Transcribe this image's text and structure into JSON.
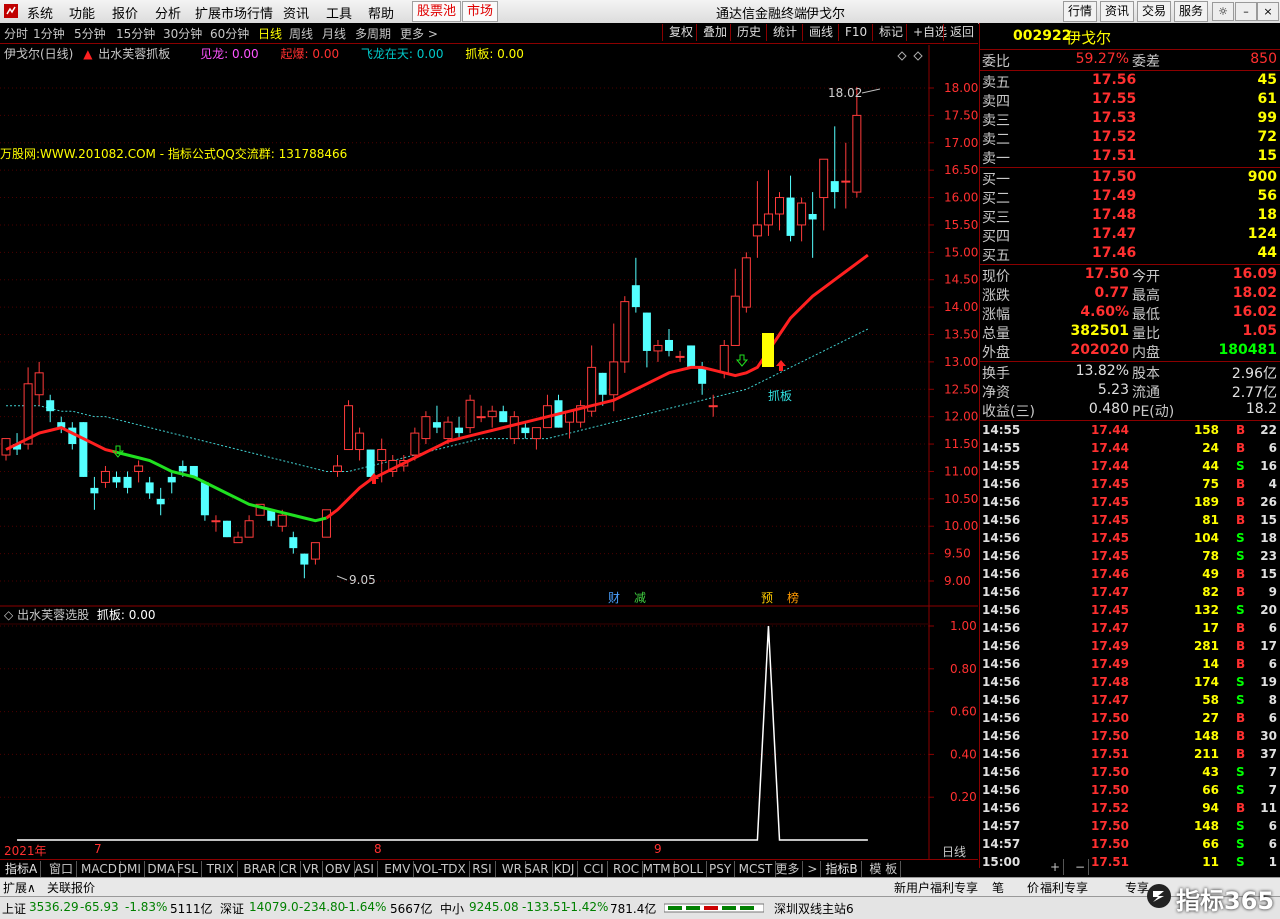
{
  "menu": {
    "items": [
      "系统",
      "功能",
      "报价",
      "分析",
      "扩展市场行情",
      "资讯",
      "工具",
      "帮助"
    ],
    "red_buttons": [
      "股票池",
      "市场"
    ],
    "title": "通达信金融终端",
    "stock_name": "伊戈尔",
    "right_buttons": [
      "行情",
      "资讯",
      "交易",
      "服务"
    ]
  },
  "periods": {
    "items": [
      "分时",
      "1分钟",
      "5分钟",
      "15分钟",
      "30分钟",
      "60分钟",
      "日线",
      "周线",
      "月线",
      "多周期",
      "更多 >"
    ],
    "active": "日线"
  },
  "tools": [
    "复权",
    "叠加",
    "历史",
    "统计",
    "画线",
    "F10",
    "标记",
    "+自选",
    "返回"
  ],
  "main_chart": {
    "label": "伊戈尔(日线)",
    "formula": "出水芙蓉抓板",
    "indicators": [
      {
        "name": "见龙: 0.00",
        "color": "#ff55ff"
      },
      {
        "name": "起爆: 0.00",
        "color": "#ff3030"
      },
      {
        "name": "飞龙在天: 0.00",
        "color": "#00c8c8"
      },
      {
        "name": "抓板: 0.00",
        "color": "#ffff00"
      }
    ],
    "watermark_text": "万股网:WWW.201082.COM - 指标公式QQ交流群: 131788466",
    "high_label": "18.02",
    "low_label": "9.05",
    "zhua_ban_label": "抓板",
    "y_ticks": [
      "18.00",
      "17.50",
      "17.00",
      "16.50",
      "16.00",
      "15.50",
      "15.00",
      "14.50",
      "14.00",
      "13.50",
      "13.00",
      "12.50",
      "12.00",
      "11.50",
      "11.00",
      "10.50",
      "10.00",
      "9.50",
      "9.00"
    ],
    "events": [
      {
        "text": "财",
        "color": "#4aa0ff"
      },
      {
        "text": "减",
        "color": "#40d040"
      },
      {
        "text": "预",
        "color": "#ffcc00"
      },
      {
        "text": "榜",
        "color": "#ff9900"
      }
    ]
  },
  "sub_chart": {
    "label": "出水芙蓉选股",
    "value": "抓板: 0.00",
    "y_ticks": [
      "1.00",
      "0.80",
      "0.60",
      "0.40",
      "0.20"
    ]
  },
  "x_axis": {
    "labels": [
      "2021年",
      "7",
      "8",
      "9"
    ],
    "period_label": "日线"
  },
  "chart_data": {
    "type": "candlestick",
    "dates_note_x": [
      "2021年",
      "7",
      "8",
      "9"
    ],
    "candles": [
      {
        "o": 11.3,
        "h": 11.6,
        "l": 11.2,
        "c": 11.6
      },
      {
        "o": 11.5,
        "h": 11.7,
        "l": 11.3,
        "c": 11.4
      },
      {
        "o": 11.5,
        "h": 12.9,
        "l": 11.4,
        "c": 12.6
      },
      {
        "o": 12.4,
        "h": 13.0,
        "l": 12.2,
        "c": 12.8
      },
      {
        "o": 12.3,
        "h": 12.4,
        "l": 11.9,
        "c": 12.1
      },
      {
        "o": 11.9,
        "h": 12.0,
        "l": 11.7,
        "c": 11.8
      },
      {
        "o": 11.8,
        "h": 11.9,
        "l": 11.4,
        "c": 11.5
      },
      {
        "o": 11.9,
        "h": 11.9,
        "l": 10.9,
        "c": 10.9
      },
      {
        "o": 10.7,
        "h": 10.9,
        "l": 10.3,
        "c": 10.6
      },
      {
        "o": 10.8,
        "h": 11.1,
        "l": 10.7,
        "c": 11.0
      },
      {
        "o": 10.9,
        "h": 11.0,
        "l": 10.7,
        "c": 10.8
      },
      {
        "o": 10.9,
        "h": 11.0,
        "l": 10.6,
        "c": 10.7
      },
      {
        "o": 11.0,
        "h": 11.2,
        "l": 10.8,
        "c": 11.1
      },
      {
        "o": 10.8,
        "h": 10.9,
        "l": 10.5,
        "c": 10.6
      },
      {
        "o": 10.5,
        "h": 10.7,
        "l": 10.2,
        "c": 10.4
      },
      {
        "o": 10.9,
        "h": 11.0,
        "l": 10.6,
        "c": 10.8
      },
      {
        "o": 11.1,
        "h": 11.2,
        "l": 10.9,
        "c": 11.0
      },
      {
        "o": 11.1,
        "h": 11.1,
        "l": 10.9,
        "c": 10.9
      },
      {
        "o": 10.8,
        "h": 10.8,
        "l": 10.1,
        "c": 10.2
      },
      {
        "o": 10.1,
        "h": 10.2,
        "l": 9.9,
        "c": 10.1
      },
      {
        "o": 10.1,
        "h": 10.1,
        "l": 9.8,
        "c": 9.8
      },
      {
        "o": 9.7,
        "h": 9.9,
        "l": 9.7,
        "c": 9.8
      },
      {
        "o": 9.8,
        "h": 10.2,
        "l": 9.8,
        "c": 10.1
      },
      {
        "o": 10.2,
        "h": 10.4,
        "l": 10.2,
        "c": 10.4
      },
      {
        "o": 10.3,
        "h": 10.3,
        "l": 10.0,
        "c": 10.1
      },
      {
        "o": 10.0,
        "h": 10.3,
        "l": 9.9,
        "c": 10.2
      },
      {
        "o": 9.8,
        "h": 9.9,
        "l": 9.5,
        "c": 9.6
      },
      {
        "o": 9.5,
        "h": 9.5,
        "l": 9.05,
        "c": 9.3
      },
      {
        "o": 9.4,
        "h": 9.7,
        "l": 9.3,
        "c": 9.7
      },
      {
        "o": 9.8,
        "h": 10.3,
        "l": 9.8,
        "c": 10.3
      },
      {
        "o": 11.0,
        "h": 11.3,
        "l": 10.9,
        "c": 11.1
      },
      {
        "o": 11.4,
        "h": 12.3,
        "l": 11.4,
        "c": 12.2
      },
      {
        "o": 11.4,
        "h": 11.8,
        "l": 11.2,
        "c": 11.7
      },
      {
        "o": 11.4,
        "h": 11.4,
        "l": 10.9,
        "c": 10.9
      },
      {
        "o": 11.2,
        "h": 11.6,
        "l": 10.8,
        "c": 11.4
      },
      {
        "o": 11.0,
        "h": 11.3,
        "l": 10.9,
        "c": 11.2
      },
      {
        "o": 11.1,
        "h": 11.3,
        "l": 11.0,
        "c": 11.2
      },
      {
        "o": 11.3,
        "h": 11.8,
        "l": 11.2,
        "c": 11.7
      },
      {
        "o": 11.6,
        "h": 12.1,
        "l": 11.5,
        "c": 12.0
      },
      {
        "o": 11.9,
        "h": 12.2,
        "l": 11.7,
        "c": 11.8
      },
      {
        "o": 11.6,
        "h": 12.0,
        "l": 11.5,
        "c": 11.9
      },
      {
        "o": 11.8,
        "h": 12.0,
        "l": 11.6,
        "c": 11.7
      },
      {
        "o": 11.8,
        "h": 12.4,
        "l": 11.7,
        "c": 12.3
      },
      {
        "o": 12.0,
        "h": 12.2,
        "l": 11.9,
        "c": 12.0
      },
      {
        "o": 12.0,
        "h": 12.2,
        "l": 11.8,
        "c": 12.1
      },
      {
        "o": 12.1,
        "h": 12.2,
        "l": 11.9,
        "c": 11.9
      },
      {
        "o": 11.6,
        "h": 12.1,
        "l": 11.5,
        "c": 12.0
      },
      {
        "o": 11.8,
        "h": 11.9,
        "l": 11.6,
        "c": 11.7
      },
      {
        "o": 11.6,
        "h": 11.8,
        "l": 11.4,
        "c": 11.8
      },
      {
        "o": 11.8,
        "h": 12.4,
        "l": 11.8,
        "c": 12.2
      },
      {
        "o": 12.3,
        "h": 12.4,
        "l": 11.8,
        "c": 11.8
      },
      {
        "o": 11.9,
        "h": 12.1,
        "l": 11.6,
        "c": 12.1
      },
      {
        "o": 11.9,
        "h": 12.3,
        "l": 11.8,
        "c": 12.2
      },
      {
        "o": 12.1,
        "h": 13.3,
        "l": 12.0,
        "c": 12.9
      },
      {
        "o": 12.8,
        "h": 12.8,
        "l": 12.2,
        "c": 12.4
      },
      {
        "o": 12.4,
        "h": 13.7,
        "l": 12.1,
        "c": 13.0
      },
      {
        "o": 13.0,
        "h": 14.2,
        "l": 12.8,
        "c": 14.1
      },
      {
        "o": 14.4,
        "h": 14.9,
        "l": 13.9,
        "c": 14.0
      },
      {
        "o": 13.9,
        "h": 13.9,
        "l": 12.9,
        "c": 13.2
      },
      {
        "o": 13.2,
        "h": 13.4,
        "l": 13.0,
        "c": 13.3
      },
      {
        "o": 13.4,
        "h": 13.6,
        "l": 13.1,
        "c": 13.2
      },
      {
        "o": 13.1,
        "h": 13.2,
        "l": 13.0,
        "c": 13.1
      },
      {
        "o": 13.3,
        "h": 13.3,
        "l": 12.9,
        "c": 12.9
      },
      {
        "o": 12.9,
        "h": 13.0,
        "l": 12.4,
        "c": 12.6
      },
      {
        "o": 12.2,
        "h": 12.4,
        "l": 12.0,
        "c": 12.2
      },
      {
        "o": 12.8,
        "h": 13.4,
        "l": 12.7,
        "c": 13.3
      },
      {
        "o": 13.3,
        "h": 14.7,
        "l": 13.3,
        "c": 14.2
      },
      {
        "o": 14.0,
        "h": 15.0,
        "l": 13.9,
        "c": 14.9
      },
      {
        "o": 15.3,
        "h": 16.3,
        "l": 14.9,
        "c": 15.5
      },
      {
        "o": 15.5,
        "h": 16.5,
        "l": 15.3,
        "c": 15.7
      },
      {
        "o": 15.7,
        "h": 16.1,
        "l": 15.4,
        "c": 16.0
      },
      {
        "o": 16.0,
        "h": 16.4,
        "l": 15.2,
        "c": 15.3
      },
      {
        "o": 15.5,
        "h": 16.0,
        "l": 15.2,
        "c": 15.9
      },
      {
        "o": 15.7,
        "h": 16.1,
        "l": 14.9,
        "c": 15.6
      },
      {
        "o": 16.0,
        "h": 16.7,
        "l": 15.4,
        "c": 16.7
      },
      {
        "o": 16.3,
        "h": 17.3,
        "l": 15.8,
        "c": 16.1
      },
      {
        "o": 16.3,
        "h": 17.0,
        "l": 15.8,
        "c": 16.3
      },
      {
        "o": 16.1,
        "h": 18.02,
        "l": 16.0,
        "c": 17.5
      }
    ],
    "ma_fast": [
      11.4,
      11.5,
      11.6,
      11.7,
      11.75,
      11.8,
      11.7,
      11.6,
      11.5,
      11.4,
      11.35,
      11.3,
      11.25,
      11.2,
      11.1,
      11.0,
      10.95,
      10.9,
      10.8,
      10.7,
      10.6,
      10.5,
      10.4,
      10.35,
      10.3,
      10.25,
      10.2,
      10.15,
      10.1,
      10.15,
      10.3,
      10.5,
      10.7,
      10.85,
      10.95,
      11.05,
      11.15,
      11.25,
      11.35,
      11.45,
      11.55,
      11.6,
      11.65,
      11.7,
      11.75,
      11.8,
      11.85,
      11.9,
      11.95,
      12.0,
      12.05,
      12.1,
      12.15,
      12.2,
      12.25,
      12.3,
      12.4,
      12.5,
      12.6,
      12.7,
      12.8,
      12.85,
      12.9,
      12.9,
      12.85,
      12.8,
      12.75,
      12.8,
      12.9,
      13.2,
      13.5,
      13.8,
      14.0,
      14.2,
      14.35,
      14.5,
      14.65,
      14.8,
      14.95
    ],
    "ma_fast_color_segments": [
      {
        "from": 0,
        "to": 10,
        "color": "#ff2020"
      },
      {
        "from": 10,
        "to": 29,
        "color": "#20e020"
      },
      {
        "from": 29,
        "to": 79,
        "color": "#ff2020"
      }
    ],
    "ma_slow_dotted": [
      12.2,
      12.2,
      12.2,
      12.2,
      12.15,
      12.1,
      12.1,
      12.05,
      12.0,
      12.0,
      11.95,
      11.9,
      11.85,
      11.8,
      11.75,
      11.7,
      11.65,
      11.6,
      11.55,
      11.5,
      11.45,
      11.4,
      11.35,
      11.3,
      11.25,
      11.2,
      11.15,
      11.1,
      11.05,
      11.0,
      11.0,
      11.0,
      11.05,
      11.1,
      11.15,
      11.2,
      11.25,
      11.3,
      11.35,
      11.4,
      11.45,
      11.5,
      11.55,
      11.6,
      11.6,
      11.6,
      11.6,
      11.6,
      11.6,
      11.6,
      11.65,
      11.7,
      11.75,
      11.8,
      11.85,
      11.9,
      11.95,
      12.0,
      12.05,
      12.1,
      12.15,
      12.2,
      12.25,
      12.3,
      12.35,
      12.4,
      12.45,
      12.5,
      12.6,
      12.7,
      12.8,
      12.9,
      13.0,
      13.1,
      13.2,
      13.3,
      13.4,
      13.5,
      13.6
    ],
    "y_range": [
      8.85,
      18.4
    ],
    "sub_series": {
      "name": "抓板",
      "peak_index": 62,
      "values_note": "0 except peak 1.00"
    }
  },
  "quote": {
    "code": "002922",
    "name": "伊戈尔",
    "weibi": {
      "label": "委比",
      "value": "59.27%",
      "label2": "委差",
      "value2": "850"
    },
    "sell": [
      {
        "label": "卖五",
        "price": "17.56",
        "vol": "45"
      },
      {
        "label": "卖四",
        "price": "17.55",
        "vol": "61"
      },
      {
        "label": "卖三",
        "price": "17.53",
        "vol": "99"
      },
      {
        "label": "卖二",
        "price": "17.52",
        "vol": "72"
      },
      {
        "label": "卖一",
        "price": "17.51",
        "vol": "15"
      }
    ],
    "buy": [
      {
        "label": "买一",
        "price": "17.50",
        "vol": "900"
      },
      {
        "label": "买二",
        "price": "17.49",
        "vol": "56"
      },
      {
        "label": "买三",
        "price": "17.48",
        "vol": "18"
      },
      {
        "label": "买四",
        "price": "17.47",
        "vol": "124"
      },
      {
        "label": "买五",
        "price": "17.46",
        "vol": "44"
      }
    ],
    "stats": [
      {
        "l1": "现价",
        "v1": "17.50",
        "c1": "#ff3030",
        "l2": "今开",
        "v2": "16.09",
        "c2": "#ff3030"
      },
      {
        "l1": "涨跌",
        "v1": "0.77",
        "c1": "#ff3030",
        "l2": "最高",
        "v2": "18.02",
        "c2": "#ff3030"
      },
      {
        "l1": "涨幅",
        "v1": "4.60%",
        "c1": "#ff3030",
        "l2": "最低",
        "v2": "16.02",
        "c2": "#ff3030"
      },
      {
        "l1": "总量",
        "v1": "382501",
        "c1": "#ffff00",
        "l2": "量比",
        "v2": "1.05",
        "c2": "#ff3030"
      },
      {
        "l1": "外盘",
        "v1": "202020",
        "c1": "#ff3030",
        "l2": "内盘",
        "v2": "180481",
        "c2": "#00ff00"
      }
    ],
    "stats2": [
      {
        "l1": "换手",
        "v1": "13.82%",
        "l2": "股本",
        "v2": "2.96亿"
      },
      {
        "l1": "净资",
        "v1": "5.23",
        "l2": "流通",
        "v2": "2.77亿"
      },
      {
        "l1": "收益(三)",
        "v1": "0.480",
        "l2": "PE(动)",
        "v2": "18.2"
      }
    ],
    "ticks": [
      {
        "t": "14:55",
        "p": "17.44",
        "v": "158",
        "bs": "B",
        "n": "22"
      },
      {
        "t": "14:55",
        "p": "17.44",
        "v": "24",
        "bs": "B",
        "n": "6"
      },
      {
        "t": "14:55",
        "p": "17.44",
        "v": "44",
        "bs": "S",
        "n": "16"
      },
      {
        "t": "14:56",
        "p": "17.45",
        "v": "75",
        "bs": "B",
        "n": "4"
      },
      {
        "t": "14:56",
        "p": "17.45",
        "v": "189",
        "bs": "B",
        "n": "26"
      },
      {
        "t": "14:56",
        "p": "17.45",
        "v": "81",
        "bs": "B",
        "n": "15"
      },
      {
        "t": "14:56",
        "p": "17.45",
        "v": "104",
        "bs": "S",
        "n": "18"
      },
      {
        "t": "14:56",
        "p": "17.45",
        "v": "78",
        "bs": "S",
        "n": "23"
      },
      {
        "t": "14:56",
        "p": "17.46",
        "v": "49",
        "bs": "B",
        "n": "15"
      },
      {
        "t": "14:56",
        "p": "17.47",
        "v": "82",
        "bs": "B",
        "n": "9"
      },
      {
        "t": "14:56",
        "p": "17.45",
        "v": "132",
        "bs": "S",
        "n": "20"
      },
      {
        "t": "14:56",
        "p": "17.47",
        "v": "17",
        "bs": "B",
        "n": "6"
      },
      {
        "t": "14:56",
        "p": "17.49",
        "v": "281",
        "bs": "B",
        "n": "17"
      },
      {
        "t": "14:56",
        "p": "17.49",
        "v": "14",
        "bs": "B",
        "n": "6"
      },
      {
        "t": "14:56",
        "p": "17.48",
        "v": "174",
        "bs": "S",
        "n": "19"
      },
      {
        "t": "14:56",
        "p": "17.47",
        "v": "58",
        "bs": "S",
        "n": "8"
      },
      {
        "t": "14:56",
        "p": "17.50",
        "v": "27",
        "bs": "B",
        "n": "6"
      },
      {
        "t": "14:56",
        "p": "17.50",
        "v": "148",
        "bs": "B",
        "n": "30"
      },
      {
        "t": "14:56",
        "p": "17.51",
        "v": "211",
        "bs": "B",
        "n": "37"
      },
      {
        "t": "14:56",
        "p": "17.50",
        "v": "43",
        "bs": "S",
        "n": "7"
      },
      {
        "t": "14:56",
        "p": "17.50",
        "v": "66",
        "bs": "S",
        "n": "7"
      },
      {
        "t": "14:56",
        "p": "17.52",
        "v": "94",
        "bs": "B",
        "n": "11"
      },
      {
        "t": "14:57",
        "p": "17.50",
        "v": "148",
        "bs": "S",
        "n": "6"
      },
      {
        "t": "14:57",
        "p": "17.50",
        "v": "66",
        "bs": "S",
        "n": "6"
      },
      {
        "t": "15:00",
        "p": "17.51",
        "v": "11",
        "bs": "S",
        "n": "1"
      }
    ]
  },
  "ind_tabs": [
    "指标A",
    "窗口",
    "MACD",
    "DMI",
    "DMA",
    "FSL",
    "TRIX",
    "BRAR",
    "CR",
    "VR",
    "OBV",
    "ASI",
    "EMV",
    "VOL-TDX",
    "RSI",
    "WR",
    "SAR",
    "KDJ",
    "CCI",
    "ROC",
    "MTM",
    "BOLL",
    "PSY",
    "MCST",
    "更多",
    ">",
    "指标B",
    "模 板"
  ],
  "ext_bar": {
    "left": [
      "扩展∧",
      "关联报价"
    ],
    "right": [
      "新用户福利专享",
      "笔",
      "价",
      "福利专享",
      "专享"
    ]
  },
  "status_bar": [
    {
      "label": "上证",
      "value": "3536.29",
      "change": "-65.93",
      "pct": "-1.83%",
      "amount": "5111亿"
    },
    {
      "label": "深证",
      "value": "14079.0",
      "change": "-234.80",
      "pct": "-1.64%",
      "amount": "5667亿"
    },
    {
      "label": "中小",
      "value": "9245.08",
      "change": "-133.51",
      "pct": "-1.42%",
      "amount": "781.4亿"
    }
  ],
  "status_right": "深圳双线主站6",
  "brand": "指标365"
}
